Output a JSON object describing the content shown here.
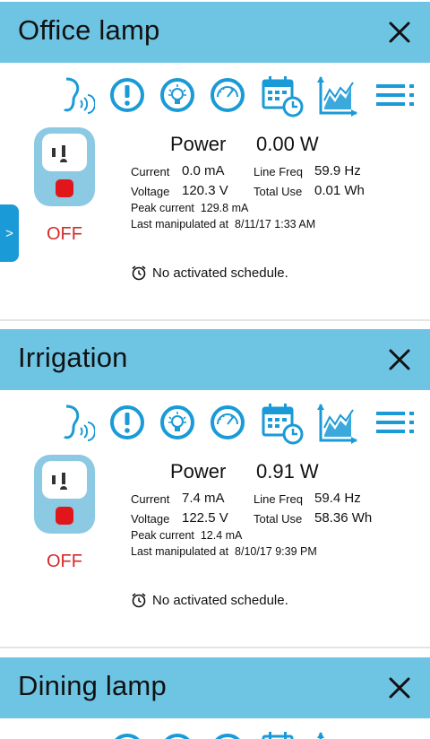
{
  "colors": {
    "header": "#6ec5e3",
    "accent": "#1a9ad6",
    "off": "#d42b2b",
    "plug_body": "#8ccae3",
    "plug_button": "#e0161b"
  },
  "side_tab": {
    "label": ">"
  },
  "cards": [
    {
      "title": "Office lamp",
      "close_label": "✕",
      "power_label": "Power",
      "power_value": "0.00 W",
      "current_label": "Current",
      "current_value": "0.0 mA",
      "voltage_label": "Voltage",
      "voltage_value": "120.3 V",
      "linefreq_label": "Line Freq",
      "linefreq_value": "59.9 Hz",
      "totaluse_label": "Total Use",
      "totaluse_value": "0.01 Wh",
      "peak_current": "Peak current  129.8 mA",
      "last_manipulated": "Last manipulated at  8/11/17 1:33 AM",
      "state": "OFF",
      "schedule": "No activated schedule."
    },
    {
      "title": "Irrigation",
      "close_label": "✕",
      "power_label": "Power",
      "power_value": "0.91 W",
      "current_label": "Current",
      "current_value": "7.4 mA",
      "voltage_label": "Voltage",
      "voltage_value": "122.5 V",
      "linefreq_label": "Line Freq",
      "linefreq_value": "59.4 Hz",
      "totaluse_label": "Total Use",
      "totaluse_value": "58.36 Wh",
      "peak_current": "Peak current  12.4 mA",
      "last_manipulated": "Last manipulated at  8/10/17 9:39 PM",
      "state": "OFF",
      "schedule": "No activated schedule."
    },
    {
      "title": "Dining lamp",
      "close_label": "✕"
    }
  ],
  "toolbar_icons": [
    "voice-icon",
    "alert-icon",
    "light-bulb-icon",
    "gauge-icon",
    "calendar-schedule-icon",
    "chart-icon",
    "menu-icon"
  ]
}
